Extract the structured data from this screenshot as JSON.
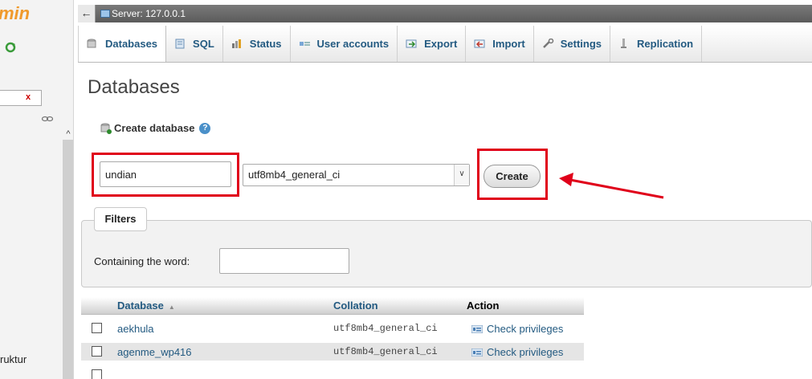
{
  "nav": {
    "logo_text": "min",
    "filter_clear": "x",
    "scroll_up": "^",
    "partial_item": "ruktur"
  },
  "topbar": {
    "back": "←",
    "server_label": "Server: 127.0.0.1"
  },
  "tabs": [
    {
      "label": "Databases",
      "icon": "database-icon",
      "active": true
    },
    {
      "label": "SQL",
      "icon": "sql-icon",
      "active": false
    },
    {
      "label": "Status",
      "icon": "status-icon",
      "active": false
    },
    {
      "label": "User accounts",
      "icon": "users-icon",
      "active": false
    },
    {
      "label": "Export",
      "icon": "export-icon",
      "active": false
    },
    {
      "label": "Import",
      "icon": "import-icon",
      "active": false
    },
    {
      "label": "Settings",
      "icon": "settings-icon",
      "active": false
    },
    {
      "label": "Replication",
      "icon": "replication-icon",
      "active": false
    }
  ],
  "main": {
    "title": "Databases",
    "create_heading": "Create database",
    "db_name_value": "undian",
    "collation_value": "utf8mb4_general_ci",
    "create_button": "Create",
    "filters_legend": "Filters",
    "containing_label": "Containing the word:",
    "containing_value": ""
  },
  "table": {
    "columns": [
      "Database",
      "Collation",
      "Action"
    ],
    "rows": [
      {
        "name": "aekhula",
        "collation": "utf8mb4_general_ci",
        "action": "Check privileges"
      },
      {
        "name": "agenme_wp416",
        "collation": "utf8mb4_general_ci",
        "action": "Check privileges"
      }
    ]
  },
  "colors": {
    "link": "#235a81",
    "highlight": "#e0001a",
    "logo": "#f09a2c"
  }
}
